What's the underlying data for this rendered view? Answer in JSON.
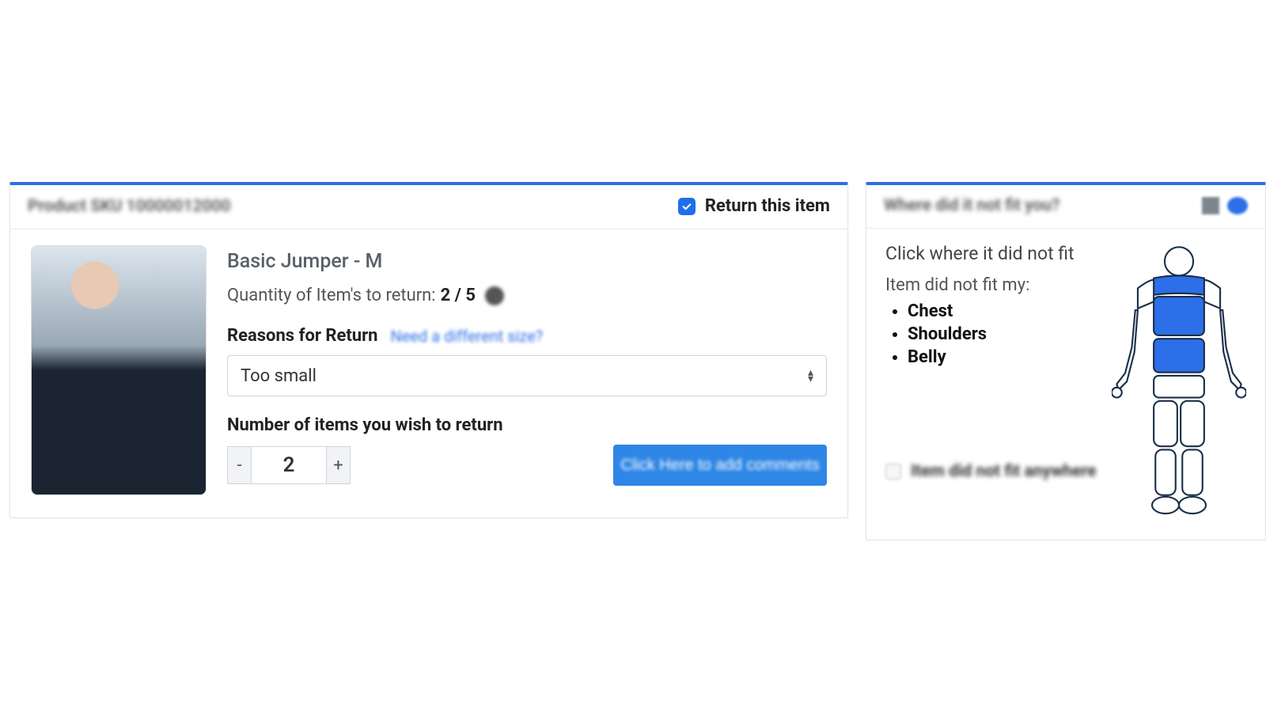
{
  "leftCard": {
    "headerBlur": "Product SKU 10000012000",
    "returnLabel": "Return this item",
    "checked": true,
    "productTitle": "Basic Jumper - M",
    "qtyPrefix": "Quantity of Item's to return: ",
    "qtyValue": "2 / 5",
    "reasonLabel": "Reasons for Return",
    "reasonLinkBlur": "Need a different size?",
    "reasonSelected": "Too small",
    "numberLabel": "Number of items you wish to return",
    "stepperMinus": "-",
    "stepperValue": "2",
    "stepperPlus": "+",
    "commentsBtn": "Click Here to add comments"
  },
  "rightCard": {
    "headerBlur": "Where did it not fit you?",
    "clickTitle": "Click where it did not fit",
    "fitIntro": "Item did not fit my:",
    "fitAreas": [
      "Chest",
      "Shoulders",
      "Belly"
    ],
    "anywhereBlur": "Item did not fit anywhere"
  }
}
